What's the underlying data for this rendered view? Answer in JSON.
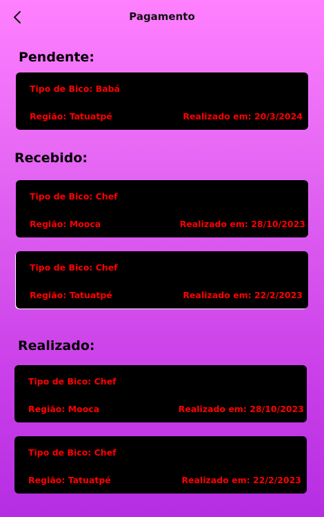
{
  "header": {
    "title": "Pagamento",
    "back_icon": "chevron-left-icon"
  },
  "sections": {
    "pendente": {
      "title": "Pendente:",
      "cards": [
        {
          "tipo": "Tipo de Bico: Babá",
          "regiao": "Região: Tatuatpé",
          "data": "Realizado em: 20/3/2024"
        }
      ]
    },
    "recebido": {
      "title": "Recebido:",
      "cards": [
        {
          "tipo": "Tipo de Bico: Chef",
          "regiao": "Região: Mooca",
          "data": "Realizado em: 28/10/2023"
        },
        {
          "tipo": "Tipo de Bico: Chef",
          "regiao": "Região: Tatuatpé",
          "data": "Realizado em: 22/2/2023"
        }
      ]
    },
    "realizado": {
      "title": "Realizado:",
      "cards": [
        {
          "tipo": "Tipo de Bico: Chef",
          "regiao": "Região: Mooca",
          "data": "Realizado em: 28/10/2023"
        },
        {
          "tipo": "Tipo de Bico: Chef",
          "regiao": "Região: Tatuatpé",
          "data": "Realizado em: 22/2/2023"
        }
      ]
    }
  },
  "colors": {
    "card_background": "#000000",
    "card_text": "#ff0000",
    "background_top": "#ff80ff",
    "background_bottom": "#b52ee2"
  }
}
